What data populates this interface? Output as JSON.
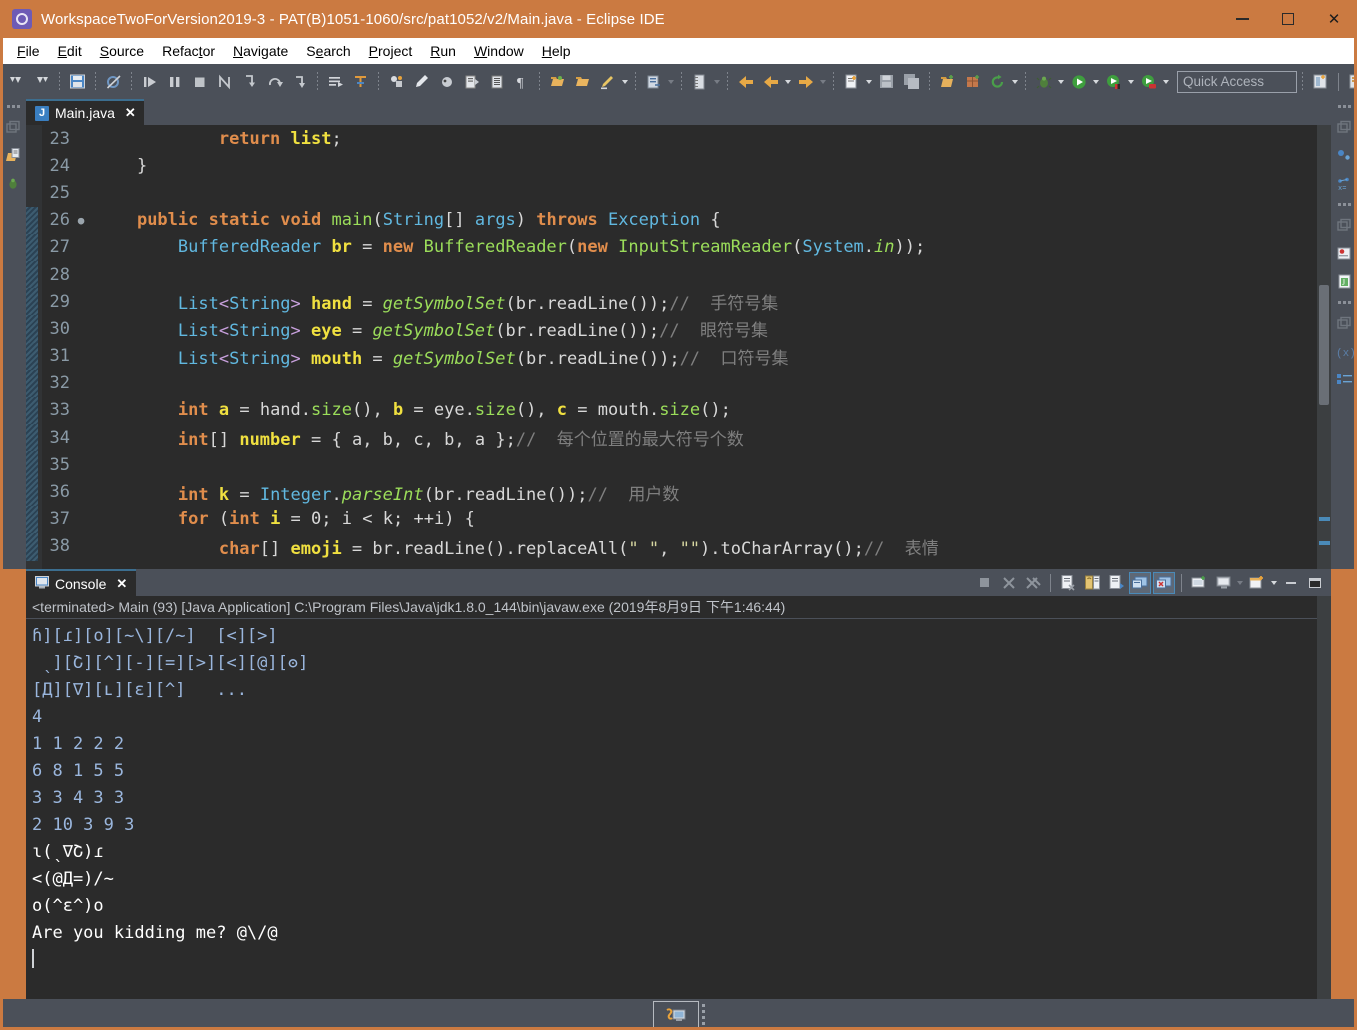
{
  "window": {
    "title": "WorkspaceTwoForVersion2019-3 - PAT(B)1051-1060/src/pat1052/v2/Main.java - Eclipse IDE",
    "app_icon": "eclipse-icon",
    "minimize_label": "Minimize",
    "maximize_label": "Maximize",
    "close_label": "Close"
  },
  "menubar": {
    "items": [
      {
        "label": "File",
        "mnemonic": "F"
      },
      {
        "label": "Edit",
        "mnemonic": "E"
      },
      {
        "label": "Source",
        "mnemonic": "S"
      },
      {
        "label": "Refactor",
        "mnemonic": "t"
      },
      {
        "label": "Navigate",
        "mnemonic": "N"
      },
      {
        "label": "Search",
        "mnemonic": "e"
      },
      {
        "label": "Project",
        "mnemonic": "P"
      },
      {
        "label": "Run",
        "mnemonic": "R"
      },
      {
        "label": "Window",
        "mnemonic": "W"
      },
      {
        "label": "Help",
        "mnemonic": "H"
      }
    ]
  },
  "toolbar": {
    "quick_access_placeholder": "Quick Access",
    "buttons": [
      "undo-icon",
      "redo-icon",
      "save-icon",
      "skip-breakpoints-icon",
      "resume-icon",
      "suspend-icon",
      "terminate-icon",
      "disconnect-icon",
      "step-into-icon",
      "step-over-icon",
      "step-return-icon",
      "open-task-icon",
      "new-java-class-icon",
      "toggle-mark-occurrences-icon",
      "edit-icon",
      "debug-perspective-icon",
      "next-annotation-icon",
      "show-whitespace-icon",
      "pilcrow-icon",
      "open-type-icon",
      "open-folder-icon",
      "highlight-icon",
      "external-tools-icon",
      "measure-icon",
      "back-icon",
      "back-arrow-icon",
      "forward-arrow-icon",
      "new-wizard-icon",
      "save-file-icon",
      "save-all-icon",
      "new-project-icon",
      "new-package-icon",
      "refresh-icon",
      "debug-bug-icon",
      "run-icon",
      "run-config-icon",
      "coverage-icon"
    ]
  },
  "left_rail": {
    "icons": [
      "restore-view-icon",
      "package-explorer-icon",
      "debug-bug-icon"
    ]
  },
  "right_rail": {
    "icons": [
      "restore-view-icon",
      "outline-icon",
      "variables-icon",
      "breakpoints-icon",
      "javadoc-icon",
      "restore-view-2-icon",
      "expressions-icon",
      "outline-list-icon"
    ]
  },
  "editor": {
    "tab": {
      "label": "Main.java",
      "icon": "java-file-icon",
      "close_label": "✕"
    },
    "lines": [
      {
        "num": "23",
        "fold": "",
        "selected": false,
        "tokens": [
          {
            "t": "            ",
            "c": "p"
          },
          {
            "t": "return",
            "c": "k"
          },
          {
            "t": " ",
            "c": "p"
          },
          {
            "t": "list",
            "c": "v"
          },
          {
            "t": ";",
            "c": "p"
          }
        ]
      },
      {
        "num": "24",
        "fold": "",
        "selected": false,
        "tokens": [
          {
            "t": "    }",
            "c": "p"
          }
        ]
      },
      {
        "num": "25",
        "fold": "",
        "selected": false,
        "tokens": []
      },
      {
        "num": "26",
        "fold": "●",
        "selected": true,
        "tokens": [
          {
            "t": "    ",
            "c": "p"
          },
          {
            "t": "public",
            "c": "k"
          },
          {
            "t": " ",
            "c": "p"
          },
          {
            "t": "static",
            "c": "k"
          },
          {
            "t": " ",
            "c": "p"
          },
          {
            "t": "void",
            "c": "k"
          },
          {
            "t": " ",
            "c": "p"
          },
          {
            "t": "main",
            "c": "m"
          },
          {
            "t": "(",
            "c": "p"
          },
          {
            "t": "String",
            "c": "t"
          },
          {
            "t": "[] ",
            "c": "p"
          },
          {
            "t": "args",
            "c": "t"
          },
          {
            "t": ") ",
            "c": "p"
          },
          {
            "t": "throws",
            "c": "k"
          },
          {
            "t": " ",
            "c": "p"
          },
          {
            "t": "Exception",
            "c": "t"
          },
          {
            "t": " {",
            "c": "p"
          }
        ]
      },
      {
        "num": "27",
        "fold": "",
        "selected": true,
        "tokens": [
          {
            "t": "        ",
            "c": "p"
          },
          {
            "t": "BufferedReader",
            "c": "t"
          },
          {
            "t": " ",
            "c": "p"
          },
          {
            "t": "br",
            "c": "v"
          },
          {
            "t": " = ",
            "c": "p"
          },
          {
            "t": "new",
            "c": "k"
          },
          {
            "t": " ",
            "c": "p"
          },
          {
            "t": "BufferedReader",
            "c": "t2"
          },
          {
            "t": "(",
            "c": "p"
          },
          {
            "t": "new",
            "c": "k"
          },
          {
            "t": " ",
            "c": "p"
          },
          {
            "t": "InputStreamReader",
            "c": "t2"
          },
          {
            "t": "(",
            "c": "p"
          },
          {
            "t": "System",
            "c": "t"
          },
          {
            "t": ".",
            "c": "p"
          },
          {
            "t": "in",
            "c": "mi"
          },
          {
            "t": "));",
            "c": "p"
          }
        ]
      },
      {
        "num": "28",
        "fold": "",
        "selected": true,
        "tokens": []
      },
      {
        "num": "29",
        "fold": "",
        "selected": true,
        "tokens": [
          {
            "t": "        ",
            "c": "p"
          },
          {
            "t": "List",
            "c": "t"
          },
          {
            "t": "<",
            "c": "s"
          },
          {
            "t": "String",
            "c": "t"
          },
          {
            "t": "> ",
            "c": "s"
          },
          {
            "t": "hand",
            "c": "v"
          },
          {
            "t": " = ",
            "c": "p"
          },
          {
            "t": "getSymbolSet",
            "c": "mi"
          },
          {
            "t": "(",
            "c": "p"
          },
          {
            "t": "br",
            "c": "p"
          },
          {
            "t": ".",
            "c": "p"
          },
          {
            "t": "readLine",
            "c": "p"
          },
          {
            "t": "());",
            "c": "p"
          },
          {
            "t": "// ",
            "c": "c"
          },
          {
            "t": " 手符号集",
            "c": "c"
          }
        ]
      },
      {
        "num": "30",
        "fold": "",
        "selected": true,
        "tokens": [
          {
            "t": "        ",
            "c": "p"
          },
          {
            "t": "List",
            "c": "t"
          },
          {
            "t": "<",
            "c": "s"
          },
          {
            "t": "String",
            "c": "t"
          },
          {
            "t": "> ",
            "c": "s"
          },
          {
            "t": "eye",
            "c": "v"
          },
          {
            "t": " = ",
            "c": "p"
          },
          {
            "t": "getSymbolSet",
            "c": "mi"
          },
          {
            "t": "(",
            "c": "p"
          },
          {
            "t": "br",
            "c": "p"
          },
          {
            "t": ".",
            "c": "p"
          },
          {
            "t": "readLine",
            "c": "p"
          },
          {
            "t": "());",
            "c": "p"
          },
          {
            "t": "// ",
            "c": "c"
          },
          {
            "t": " 眼符号集",
            "c": "c"
          }
        ]
      },
      {
        "num": "31",
        "fold": "",
        "selected": true,
        "tokens": [
          {
            "t": "        ",
            "c": "p"
          },
          {
            "t": "List",
            "c": "t"
          },
          {
            "t": "<",
            "c": "s"
          },
          {
            "t": "String",
            "c": "t"
          },
          {
            "t": "> ",
            "c": "s"
          },
          {
            "t": "mouth",
            "c": "v"
          },
          {
            "t": " = ",
            "c": "p"
          },
          {
            "t": "getSymbolSet",
            "c": "mi"
          },
          {
            "t": "(",
            "c": "p"
          },
          {
            "t": "br",
            "c": "p"
          },
          {
            "t": ".",
            "c": "p"
          },
          {
            "t": "readLine",
            "c": "p"
          },
          {
            "t": "());",
            "c": "p"
          },
          {
            "t": "// ",
            "c": "c"
          },
          {
            "t": " 口符号集",
            "c": "c"
          }
        ]
      },
      {
        "num": "32",
        "fold": "",
        "selected": true,
        "tokens": []
      },
      {
        "num": "33",
        "fold": "",
        "selected": true,
        "tokens": [
          {
            "t": "        ",
            "c": "p"
          },
          {
            "t": "int",
            "c": "k"
          },
          {
            "t": " ",
            "c": "p"
          },
          {
            "t": "a",
            "c": "v"
          },
          {
            "t": " = ",
            "c": "p"
          },
          {
            "t": "hand",
            "c": "p"
          },
          {
            "t": ".",
            "c": "p"
          },
          {
            "t": "size",
            "c": "m"
          },
          {
            "t": "(), ",
            "c": "p"
          },
          {
            "t": "b",
            "c": "v"
          },
          {
            "t": " = ",
            "c": "p"
          },
          {
            "t": "eye",
            "c": "p"
          },
          {
            "t": ".",
            "c": "p"
          },
          {
            "t": "size",
            "c": "m"
          },
          {
            "t": "(), ",
            "c": "p"
          },
          {
            "t": "c",
            "c": "v"
          },
          {
            "t": " = ",
            "c": "p"
          },
          {
            "t": "mouth",
            "c": "p"
          },
          {
            "t": ".",
            "c": "p"
          },
          {
            "t": "size",
            "c": "m"
          },
          {
            "t": "();",
            "c": "p"
          }
        ]
      },
      {
        "num": "34",
        "fold": "",
        "selected": true,
        "tokens": [
          {
            "t": "        ",
            "c": "p"
          },
          {
            "t": "int",
            "c": "k"
          },
          {
            "t": "[] ",
            "c": "p"
          },
          {
            "t": "number",
            "c": "v"
          },
          {
            "t": " = { ",
            "c": "p"
          },
          {
            "t": "a",
            "c": "p"
          },
          {
            "t": ", ",
            "c": "p"
          },
          {
            "t": "b",
            "c": "p"
          },
          {
            "t": ", ",
            "c": "p"
          },
          {
            "t": "c",
            "c": "p"
          },
          {
            "t": ", ",
            "c": "p"
          },
          {
            "t": "b",
            "c": "p"
          },
          {
            "t": ", ",
            "c": "p"
          },
          {
            "t": "a",
            "c": "p"
          },
          {
            "t": " };",
            "c": "p"
          },
          {
            "t": "// ",
            "c": "c"
          },
          {
            "t": " 每个位置的最大符号个数",
            "c": "c"
          }
        ]
      },
      {
        "num": "35",
        "fold": "",
        "selected": true,
        "tokens": []
      },
      {
        "num": "36",
        "fold": "",
        "selected": true,
        "tokens": [
          {
            "t": "        ",
            "c": "p"
          },
          {
            "t": "int",
            "c": "k"
          },
          {
            "t": " ",
            "c": "p"
          },
          {
            "t": "k",
            "c": "v"
          },
          {
            "t": " = ",
            "c": "p"
          },
          {
            "t": "Integer",
            "c": "t"
          },
          {
            "t": ".",
            "c": "p"
          },
          {
            "t": "parseInt",
            "c": "mi"
          },
          {
            "t": "(",
            "c": "p"
          },
          {
            "t": "br",
            "c": "p"
          },
          {
            "t": ".",
            "c": "p"
          },
          {
            "t": "readLine",
            "c": "p"
          },
          {
            "t": "());",
            "c": "p"
          },
          {
            "t": "// ",
            "c": "c"
          },
          {
            "t": " 用户数",
            "c": "c"
          }
        ]
      },
      {
        "num": "37",
        "fold": "",
        "selected": true,
        "tokens": [
          {
            "t": "        ",
            "c": "p"
          },
          {
            "t": "for",
            "c": "k"
          },
          {
            "t": " (",
            "c": "p"
          },
          {
            "t": "int",
            "c": "k"
          },
          {
            "t": " ",
            "c": "p"
          },
          {
            "t": "i",
            "c": "v"
          },
          {
            "t": " = ",
            "c": "p"
          },
          {
            "t": "0",
            "c": "p"
          },
          {
            "t": "; ",
            "c": "p"
          },
          {
            "t": "i",
            "c": "p"
          },
          {
            "t": " < ",
            "c": "p"
          },
          {
            "t": "k",
            "c": "p"
          },
          {
            "t": "; ++",
            "c": "p"
          },
          {
            "t": "i",
            "c": "p"
          },
          {
            "t": ") {",
            "c": "p"
          }
        ]
      },
      {
        "num": "38",
        "fold": "",
        "selected": true,
        "tokens": [
          {
            "t": "            ",
            "c": "p"
          },
          {
            "t": "char",
            "c": "k"
          },
          {
            "t": "[] ",
            "c": "p"
          },
          {
            "t": "emoji",
            "c": "v"
          },
          {
            "t": " = ",
            "c": "p"
          },
          {
            "t": "br",
            "c": "p"
          },
          {
            "t": ".",
            "c": "p"
          },
          {
            "t": "readLine",
            "c": "p"
          },
          {
            "t": "().",
            "c": "p"
          },
          {
            "t": "replaceAll",
            "c": "p"
          },
          {
            "t": "(",
            "c": "p"
          },
          {
            "t": "\" \"",
            "c": "st"
          },
          {
            "t": ", ",
            "c": "p"
          },
          {
            "t": "\"\"",
            "c": "st"
          },
          {
            "t": ").",
            "c": "p"
          },
          {
            "t": "toCharArray",
            "c": "p"
          },
          {
            "t": "();",
            "c": "p"
          },
          {
            "t": "// ",
            "c": "c"
          },
          {
            "t": " 表情",
            "c": "c"
          }
        ]
      }
    ]
  },
  "console": {
    "tab": {
      "label": "Console",
      "icon": "console-icon",
      "close_label": "✕"
    },
    "terminated_line": "<terminated> Main (93) [Java Application] C:\\Program Files\\Java\\jdk1.8.0_144\\bin\\javaw.exe (2019年8月9日 下午1:46:44)",
    "tools": [
      "terminate-icon",
      "remove-launch-icon",
      "remove-all-terminated-icon",
      "clear-console-icon",
      "scroll-lock-icon",
      "word-wrap-icon",
      "show-console-on-output-icon",
      "pin-console-icon",
      "display-selected-console-icon",
      "open-console-icon",
      "new-console-view-icon",
      "minimize-icon",
      "maximize-icon"
    ],
    "output": [
      {
        "text": "ɦ][ɾ][o][~\\][/~]  [<][>]",
        "stream": "in"
      },
      {
        "text": " ˎ][Շ][^][-][=][>][<][@][ʘ]",
        "stream": "in"
      },
      {
        "text": "[Д][∇][ʟ][ɛ][^]   ...",
        "stream": "in"
      },
      {
        "text": "4",
        "stream": "in"
      },
      {
        "text": "1 1 2 2 2",
        "stream": "in"
      },
      {
        "text": "6 8 1 5 5",
        "stream": "in"
      },
      {
        "text": "3 3 4 3 3",
        "stream": "in"
      },
      {
        "text": "2 10 3 9 3",
        "stream": "in"
      },
      {
        "text": "ɩ(ˎ∇Շ)ɾ",
        "stream": "out"
      },
      {
        "text": "<(@Д=)/~",
        "stream": "out"
      },
      {
        "text": "o(^ɛ^)o",
        "stream": "out"
      },
      {
        "text": "Are you kidding me? @\\/@",
        "stream": "out"
      }
    ]
  },
  "statusbar": {
    "icon": "java-perspective-icon",
    "label": ""
  },
  "colors": {
    "titlebar": "#cb7a41",
    "toolbar": "#4b5059",
    "editor_bg": "#2b2b2b",
    "console_bg": "#2b2b2b",
    "accent_tab": "#3c6e8f",
    "keyword": "#e08d4c",
    "type": "#61b8e0",
    "variable": "#f0e040",
    "method": "#9bdd5a",
    "comment": "#7f7f7f",
    "string": "#d6d6a0",
    "console_in": "#9ab6dd",
    "console_out": "#ffffff"
  }
}
